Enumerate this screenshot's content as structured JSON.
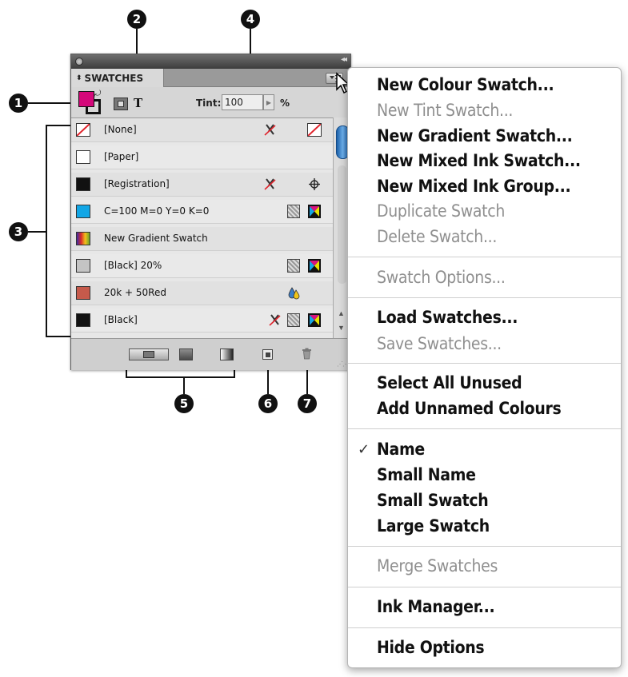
{
  "panel": {
    "tab_label": "SWATCHES",
    "tint_label": "Tint:",
    "tint_value": "100",
    "tint_unit": "%",
    "swatches": [
      {
        "name": "[None]",
        "chip": "none"
      },
      {
        "name": "[Paper]",
        "chip": "#ffffff"
      },
      {
        "name": "[Registration]",
        "chip": "#111111"
      },
      {
        "name": "C=100 M=0 Y=0 K=0",
        "chip": "#11a6e6"
      },
      {
        "name": "New Gradient Swatch",
        "chip": "gradient"
      },
      {
        "name": "[Black] 20%",
        "chip": "#c4c4c4"
      },
      {
        "name": "20k + 50Red",
        "chip": "#c65a4b"
      },
      {
        "name": "[Black]",
        "chip": "#111111"
      }
    ]
  },
  "callouts": [
    "1",
    "2",
    "3",
    "4",
    "5",
    "6",
    "7"
  ],
  "menu": {
    "items": [
      {
        "label": "New Colour Swatch...",
        "enabled": true
      },
      {
        "label": "New Tint Swatch...",
        "enabled": false
      },
      {
        "label": "New Gradient Swatch...",
        "enabled": true
      },
      {
        "label": "New Mixed Ink Swatch...",
        "enabled": true
      },
      {
        "label": "New Mixed Ink Group...",
        "enabled": true
      },
      {
        "label": "Duplicate Swatch",
        "enabled": false
      },
      {
        "label": "Delete Swatch...",
        "enabled": false
      },
      {
        "label": "Swatch Options...",
        "enabled": false
      },
      {
        "label": "Load Swatches...",
        "enabled": true
      },
      {
        "label": "Save Swatches...",
        "enabled": false
      },
      {
        "label": "Select All Unused",
        "enabled": true
      },
      {
        "label": "Add Unnamed Colours",
        "enabled": true
      },
      {
        "label": "Name",
        "enabled": true,
        "checked": true
      },
      {
        "label": "Small Name",
        "enabled": true
      },
      {
        "label": "Small Swatch",
        "enabled": true
      },
      {
        "label": "Large Swatch",
        "enabled": true
      },
      {
        "label": "Merge Swatches",
        "enabled": false
      },
      {
        "label": "Ink Manager...",
        "enabled": true
      },
      {
        "label": "Hide Options",
        "enabled": true
      }
    ]
  }
}
